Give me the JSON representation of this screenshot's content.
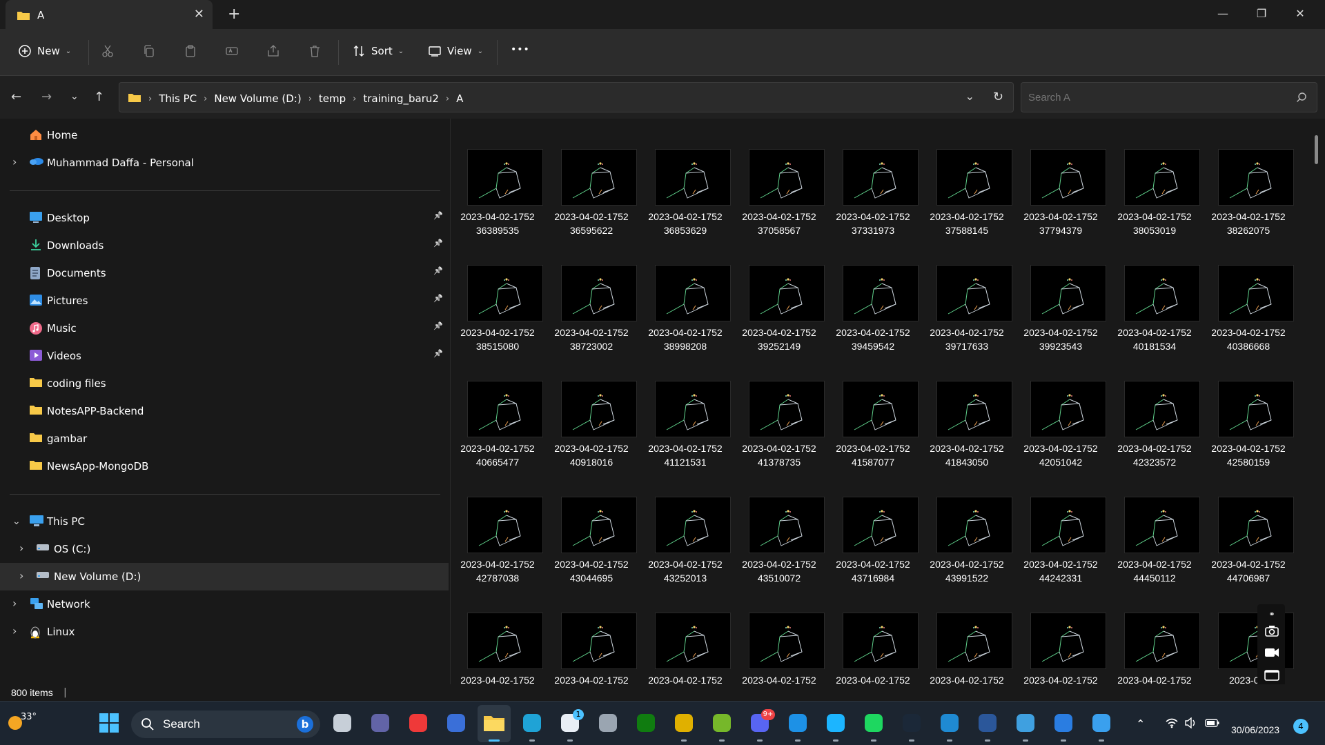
{
  "window": {
    "tab_title": "A",
    "new_tab": "+",
    "minimize": "—",
    "maximize": "❐",
    "close": "✕"
  },
  "toolbar": {
    "new_label": "New",
    "sort_label": "Sort",
    "view_label": "View",
    "more_label": "•••"
  },
  "address": {
    "breadcrumb": [
      "This PC",
      "New Volume (D:)",
      "temp",
      "training_baru2",
      "A"
    ]
  },
  "search": {
    "placeholder": "Search A"
  },
  "sidebar": {
    "top": [
      {
        "label": "Home",
        "icon": "home-icon"
      },
      {
        "label": "Muhammad Daffa - Personal",
        "icon": "onedrive-icon"
      }
    ],
    "quick_access": [
      {
        "label": "Desktop",
        "icon": "desktop-icon",
        "pinned": true
      },
      {
        "label": "Downloads",
        "icon": "download-icon",
        "pinned": true
      },
      {
        "label": "Documents",
        "icon": "documents-icon",
        "pinned": true
      },
      {
        "label": "Pictures",
        "icon": "pictures-icon",
        "pinned": true
      },
      {
        "label": "Music",
        "icon": "music-icon",
        "pinned": true
      },
      {
        "label": "Videos",
        "icon": "videos-icon",
        "pinned": true
      },
      {
        "label": "coding files",
        "icon": "folder-icon",
        "pinned": false
      },
      {
        "label": "NotesAPP-Backend",
        "icon": "folder-icon",
        "pinned": false
      },
      {
        "label": "gambar",
        "icon": "folder-icon",
        "pinned": false
      },
      {
        "label": "NewsApp-MongoDB",
        "icon": "folder-icon",
        "pinned": false
      }
    ],
    "tree": [
      {
        "label": "This PC",
        "icon": "pc-icon",
        "level": 0,
        "expanded": true
      },
      {
        "label": "OS (C:)",
        "icon": "drive-icon",
        "level": 1,
        "expanded": false
      },
      {
        "label": "New Volume (D:)",
        "icon": "drive-icon",
        "level": 1,
        "expanded": false,
        "selected": true
      },
      {
        "label": "Network",
        "icon": "network-icon",
        "level": 0,
        "expanded": false
      },
      {
        "label": "Linux",
        "icon": "linux-icon",
        "level": 0,
        "expanded": false
      }
    ]
  },
  "files": {
    "rows": [
      [
        [
          "2023-04-02-1752",
          "36389535"
        ],
        [
          "2023-04-02-1752",
          "36595622"
        ],
        [
          "2023-04-02-1752",
          "36853629"
        ],
        [
          "2023-04-02-1752",
          "37058567"
        ],
        [
          "2023-04-02-1752",
          "37331973"
        ],
        [
          "2023-04-02-1752",
          "37588145"
        ],
        [
          "2023-04-02-1752",
          "37794379"
        ],
        [
          "2023-04-02-1752",
          "38053019"
        ],
        [
          "2023-04-02-1752",
          "38262075"
        ]
      ],
      [
        [
          "2023-04-02-1752",
          "38515080"
        ],
        [
          "2023-04-02-1752",
          "38723002"
        ],
        [
          "2023-04-02-1752",
          "38998208"
        ],
        [
          "2023-04-02-1752",
          "39252149"
        ],
        [
          "2023-04-02-1752",
          "39459542"
        ],
        [
          "2023-04-02-1752",
          "39717633"
        ],
        [
          "2023-04-02-1752",
          "39923543"
        ],
        [
          "2023-04-02-1752",
          "40181534"
        ],
        [
          "2023-04-02-1752",
          "40386668"
        ]
      ],
      [
        [
          "2023-04-02-1752",
          "40665477"
        ],
        [
          "2023-04-02-1752",
          "40918016"
        ],
        [
          "2023-04-02-1752",
          "41121531"
        ],
        [
          "2023-04-02-1752",
          "41378735"
        ],
        [
          "2023-04-02-1752",
          "41587077"
        ],
        [
          "2023-04-02-1752",
          "41843050"
        ],
        [
          "2023-04-02-1752",
          "42051042"
        ],
        [
          "2023-04-02-1752",
          "42323572"
        ],
        [
          "2023-04-02-1752",
          "42580159"
        ]
      ],
      [
        [
          "2023-04-02-1752",
          "42787038"
        ],
        [
          "2023-04-02-1752",
          "43044695"
        ],
        [
          "2023-04-02-1752",
          "43252013"
        ],
        [
          "2023-04-02-1752",
          "43510072"
        ],
        [
          "2023-04-02-1752",
          "43716984"
        ],
        [
          "2023-04-02-1752",
          "43991522"
        ],
        [
          "2023-04-02-1752",
          "44242331"
        ],
        [
          "2023-04-02-1752",
          "44450112"
        ],
        [
          "2023-04-02-1752",
          "44706987"
        ]
      ],
      [
        [
          "2023-04-02-1752",
          ""
        ],
        [
          "2023-04-02-1752",
          ""
        ],
        [
          "2023-04-02-1752",
          ""
        ],
        [
          "2023-04-02-1752",
          ""
        ],
        [
          "2023-04-02-1752",
          ""
        ],
        [
          "2023-04-02-1752",
          ""
        ],
        [
          "2023-04-02-1752",
          ""
        ],
        [
          "2023-04-02-1752",
          ""
        ],
        [
          "2023-04-",
          ""
        ]
      ]
    ]
  },
  "status": {
    "item_count": "800 items"
  },
  "taskbar": {
    "weather_temp": "33°",
    "search_label": "Search",
    "store_badge": "1",
    "discord_badge": "9+",
    "clock_date": "30/06/2023",
    "notification_count": "4",
    "apps": [
      "start-icon",
      "task-view-icon",
      "teams-icon",
      "vivaldi-icon",
      "code-editor-icon",
      "file-explorer-icon",
      "edge-icon",
      "store-icon",
      "unity-icon",
      "xbox-icon",
      "chrome-icon",
      "utorrent-icon",
      "discord-icon",
      "docker-icon",
      "webstorm-icon",
      "spotify-icon",
      "steam-icon",
      "vscode-icon",
      "word-icon",
      "notepad-icon",
      "azure-data-studio-icon",
      "snipping-tool-icon"
    ]
  },
  "colors": {
    "accent": "#4cc2ff",
    "folder": "#f7c948",
    "bg": "#191919"
  }
}
